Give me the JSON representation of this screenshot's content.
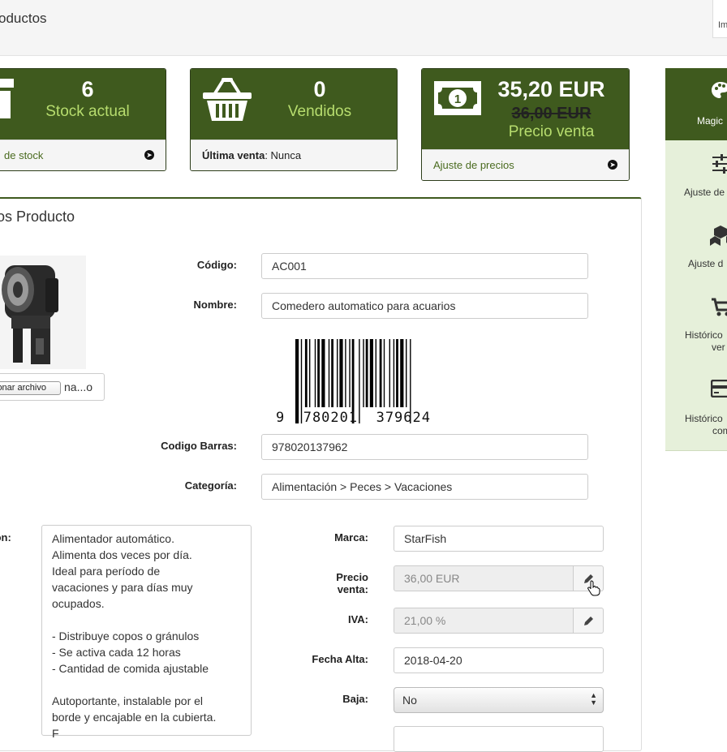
{
  "header": {
    "title": "oductos",
    "right_text": "Im"
  },
  "cards": [
    {
      "number": "6",
      "label": "Stock actual",
      "footer": "de stock"
    },
    {
      "number": "0",
      "label": "Vendidos",
      "footer_bold": "Última venta",
      "footer_rest": ": Nunca"
    },
    {
      "number": "35,20 EUR",
      "old_price": "36,00 EUR",
      "label": "Precio venta",
      "footer": "Ajuste de precios"
    }
  ],
  "sidebar": {
    "items": [
      {
        "label": "Magic"
      },
      {
        "label": "Ajuste de"
      },
      {
        "label": "Ajuste d"
      },
      {
        "label_line1": "Histórico",
        "label_line2": "ver"
      },
      {
        "label_line1": "Histórico",
        "label_line2": "com"
      }
    ]
  },
  "panel": {
    "title": "os Producto"
  },
  "file": {
    "button_label": "ionar archivo",
    "filename": "na...o"
  },
  "form": {
    "codigo_label": "Código:",
    "codigo_value": "AC001",
    "nombre_label": "Nombre:",
    "nombre_value": "Comedero automatico para acuarios",
    "barcode_human": "9  780201  379624",
    "barras_label": "Codigo Barras:",
    "barras_value": "978020137962",
    "categoria_label": "Categoría:",
    "categoria_value": "Alimentación > Peces > Vacaciones",
    "descripcion_label": "ion:",
    "descripcion_value": "Alimentador automático.\nAlimenta dos veces por día.\nIdeal para período de\nvacaciones y para días muy\nocupados.\n\n- Distribuye copos o gránulos\n- Se activa cada 12 horas\n- Cantidad de comida ajustable\n\nAutoportante, instalable por el\nborde y encajable en la cubierta.\nF",
    "marca_label": "Marca:",
    "marca_value": "StarFish",
    "precio_label_1": "Precio",
    "precio_label_2": "venta:",
    "precio_value": "36,00 EUR",
    "iva_label": "IVA:",
    "iva_value": "21,00 %",
    "fecha_label": "Fecha Alta:",
    "fecha_value": "2018-04-20",
    "baja_label": "Baja:",
    "baja_value": "No"
  }
}
